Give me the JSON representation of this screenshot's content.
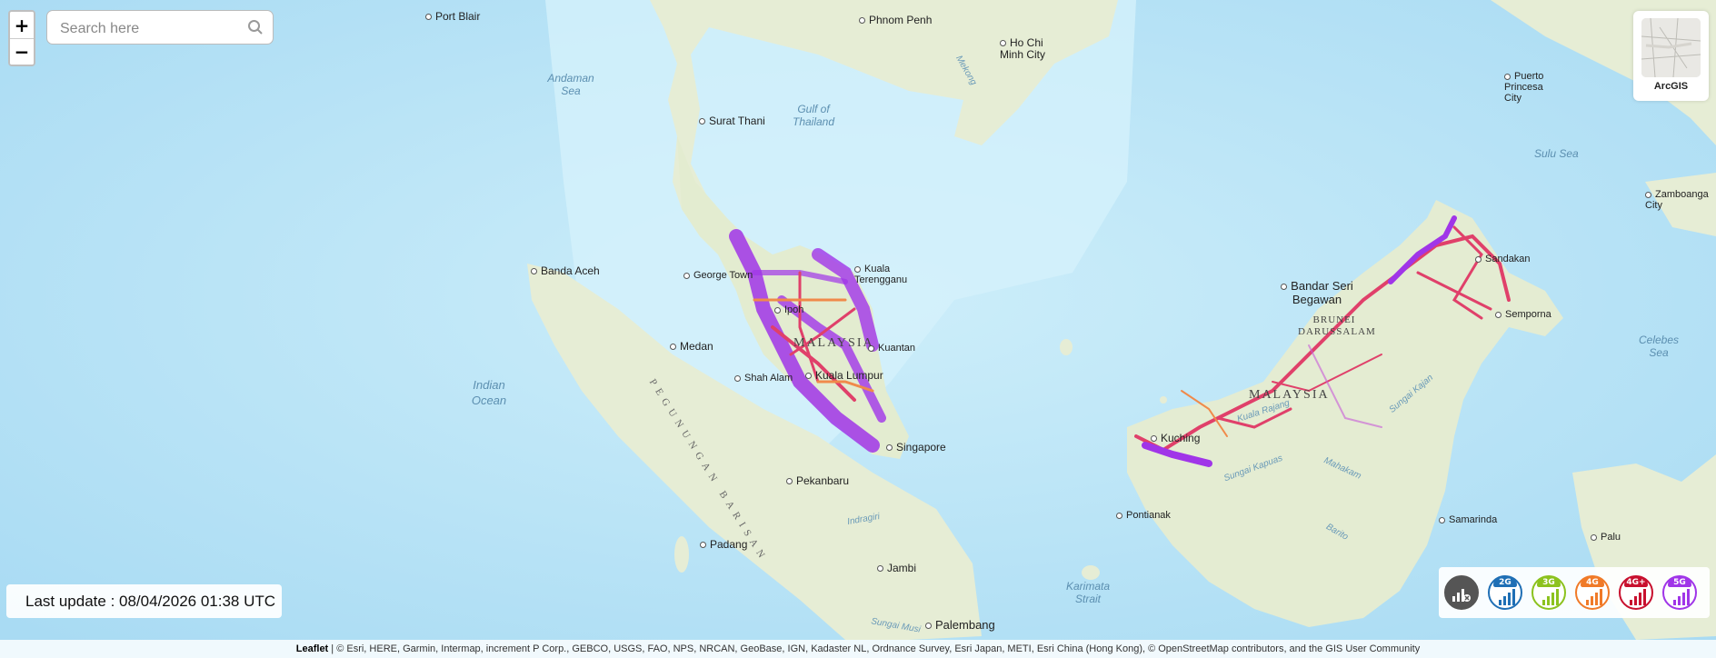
{
  "map": {
    "cities": [
      {
        "name": "Port Blair"
      },
      {
        "name": "Phnom Penh"
      },
      {
        "name": "Ho Chi Minh City"
      },
      {
        "name": "Surat Thani"
      },
      {
        "name": "Puerto Princesa City"
      },
      {
        "name": "Zamboanga City"
      },
      {
        "name": "Banda Aceh"
      },
      {
        "name": "George Town"
      },
      {
        "name": "Kuala Terengganu"
      },
      {
        "name": "Ipoh"
      },
      {
        "name": "Kuantan"
      },
      {
        "name": "Medan"
      },
      {
        "name": "Shah Alam"
      },
      {
        "name": "Kuala Lumpur"
      },
      {
        "name": "Singapore"
      },
      {
        "name": "Pekanbaru"
      },
      {
        "name": "Padang"
      },
      {
        "name": "Jambi"
      },
      {
        "name": "Palembang"
      },
      {
        "name": "Bandar Seri Begawan"
      },
      {
        "name": "Sandakan"
      },
      {
        "name": "Semporna"
      },
      {
        "name": "Kuching"
      },
      {
        "name": "Pontianak"
      },
      {
        "name": "Samarinda"
      },
      {
        "name": "Palu"
      }
    ],
    "seas": [
      {
        "name": "Andaman Sea"
      },
      {
        "name": "Gulf of Thailand"
      },
      {
        "name": "Sulu Sea"
      },
      {
        "name": "Indian Ocean"
      },
      {
        "name": "Celebes Sea"
      },
      {
        "name": "Karimata Strait"
      }
    ],
    "countries": [
      {
        "name": "MALAYSIA"
      },
      {
        "name": "MALAYSIA"
      },
      {
        "name": "BRUNEI DARUSSALAM"
      }
    ],
    "ranges": [
      {
        "name": "PEGUNUNGAN BARISAN"
      }
    ],
    "rivers": [
      {
        "name": "Mekong"
      },
      {
        "name": "Kuala Rajang"
      },
      {
        "name": "Sungai Kapuas"
      },
      {
        "name": "Mahakam"
      },
      {
        "name": "Barito"
      },
      {
        "name": "Indragiri"
      },
      {
        "name": "Sungai Musi"
      },
      {
        "name": "Sungai Kajan"
      }
    ]
  },
  "controls": {
    "zoom_in": "+",
    "zoom_out": "−",
    "search_placeholder": "Search here",
    "search_icon": "search-icon",
    "basemap_label": "ArcGIS"
  },
  "status": {
    "last_update": "Last update : 08/04/2026 01:38 UTC"
  },
  "legend": {
    "items": [
      {
        "label": "",
        "name": "no-signal",
        "color": "#555555"
      },
      {
        "label": "2G",
        "name": "2g",
        "color": "#1f6fb5"
      },
      {
        "label": "3G",
        "name": "3g",
        "color": "#8cc21e"
      },
      {
        "label": "4G",
        "name": "4g",
        "color": "#f07a28"
      },
      {
        "label": "4G+",
        "name": "4g-plus",
        "color": "#c8102e"
      },
      {
        "label": "5G",
        "name": "5g",
        "color": "#a035e8"
      }
    ]
  },
  "attribution": {
    "leaflet": "Leaflet",
    "text": " | © Esri, HERE, Garmin, Intermap, increment P Corp., GEBCO, USGS, FAO, NPS, NRCAN, GeoBase, IGN, Kadaster NL, Ordnance Survey, Esri Japan, METI, Esri China (Hong Kong), © OpenStreetMap contributors, and the GIS User Community"
  },
  "colors": {
    "sea": "#bfe6f7",
    "land": "#e8efd8",
    "coverage_5g": "#a035e8",
    "coverage_4g_plus": "#e0406a",
    "coverage_4g": "#f08a4a"
  }
}
